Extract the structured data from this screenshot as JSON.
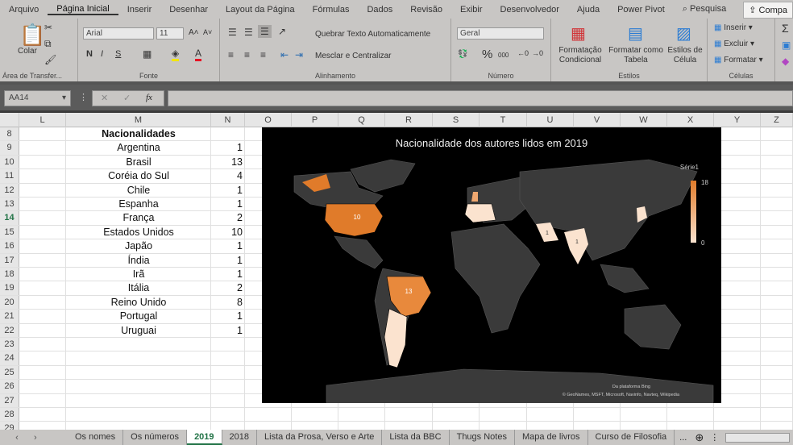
{
  "menu": {
    "tabs": [
      "Arquivo",
      "Página Inicial",
      "Inserir",
      "Desenhar",
      "Layout da Página",
      "Fórmulas",
      "Dados",
      "Revisão",
      "Exibir",
      "Desenvolvedor",
      "Ajuda",
      "Power Pivot"
    ],
    "active": "Página Inicial",
    "search": "Pesquisa",
    "share": "Compa"
  },
  "ribbon": {
    "clipboard": {
      "paste": "Colar",
      "group": "Área de Transfer..."
    },
    "font": {
      "name": "Arial",
      "size": "11",
      "bold": "N",
      "italic": "I",
      "underline": "S",
      "group": "Fonte"
    },
    "alignment": {
      "wrap": "Quebrar Texto Automaticamente",
      "merge": "Mesclar e Centralizar",
      "group": "Alinhamento"
    },
    "number": {
      "format": "Geral",
      "percent": "%",
      "thousands": "000",
      "group": "Número"
    },
    "styles": {
      "conditional": "Formatação Condicional",
      "table": "Formatar como Tabela",
      "cell": "Estilos de Célula",
      "group": "Estilos"
    },
    "cells": {
      "insert": "Inserir",
      "delete": "Excluir",
      "format": "Formatar",
      "group": "Células"
    },
    "colors": {
      "highlight": "#f2e600",
      "fontcolor": "#e81123"
    }
  },
  "formula_bar": {
    "name_box": "AA14",
    "value": ""
  },
  "columns": [
    "L",
    "M",
    "N",
    "O",
    "P",
    "Q",
    "R",
    "S",
    "T",
    "U",
    "V",
    "W",
    "X",
    "Y",
    "Z"
  ],
  "sheet": {
    "header_row": 8,
    "header": "Nacionalidades",
    "rows": [
      {
        "row": 9,
        "country": "Argentina",
        "count": 1
      },
      {
        "row": 10,
        "country": "Brasil",
        "count": 13
      },
      {
        "row": 11,
        "country": "Coréia do Sul",
        "count": 4
      },
      {
        "row": 12,
        "country": "Chile",
        "count": 1
      },
      {
        "row": 13,
        "country": "Espanha",
        "count": 1
      },
      {
        "row": 14,
        "country": "França",
        "count": 2
      },
      {
        "row": 15,
        "country": "Estados Unidos",
        "count": 10
      },
      {
        "row": 16,
        "country": "Japão",
        "count": 1
      },
      {
        "row": 17,
        "country": "Índia",
        "count": 1
      },
      {
        "row": 18,
        "country": "Irã",
        "count": 1
      },
      {
        "row": 19,
        "country": "Itália",
        "count": 2
      },
      {
        "row": 20,
        "country": "Reino Unido",
        "count": 8
      },
      {
        "row": 21,
        "country": "Portugal",
        "count": 1
      },
      {
        "row": 22,
        "country": "Uruguai",
        "count": 1
      }
    ],
    "empty_rows": [
      23,
      24,
      25,
      26,
      27,
      28,
      29
    ],
    "active_row": 14
  },
  "map_chart": {
    "title": "Nacionalidade dos autores lidos em 2019",
    "legend": {
      "series": "Série1",
      "max": "18",
      "min": "0"
    },
    "labels": {
      "us": "10",
      "brazil": "13",
      "iran": "1",
      "india": "1"
    },
    "credit1": "Da plataforma Bing",
    "credit2": "© GeoNames, MSFT, Microsoft, Navinfo, Navteq, Wikipedia",
    "colors": {
      "background": "#000000",
      "land": "#3a3a3a",
      "high": "#e07b2a",
      "low": "#fbe3cf"
    }
  },
  "sheet_tabs": [
    "Os nomes",
    "Os números",
    "2019",
    "2018",
    "Lista da Prosa, Verso e Arte",
    "Lista da BBC",
    "Thugs Notes",
    "Mapa de livros",
    "Curso de Filosofia"
  ],
  "active_tab": "2019",
  "more_tabs": "..."
}
